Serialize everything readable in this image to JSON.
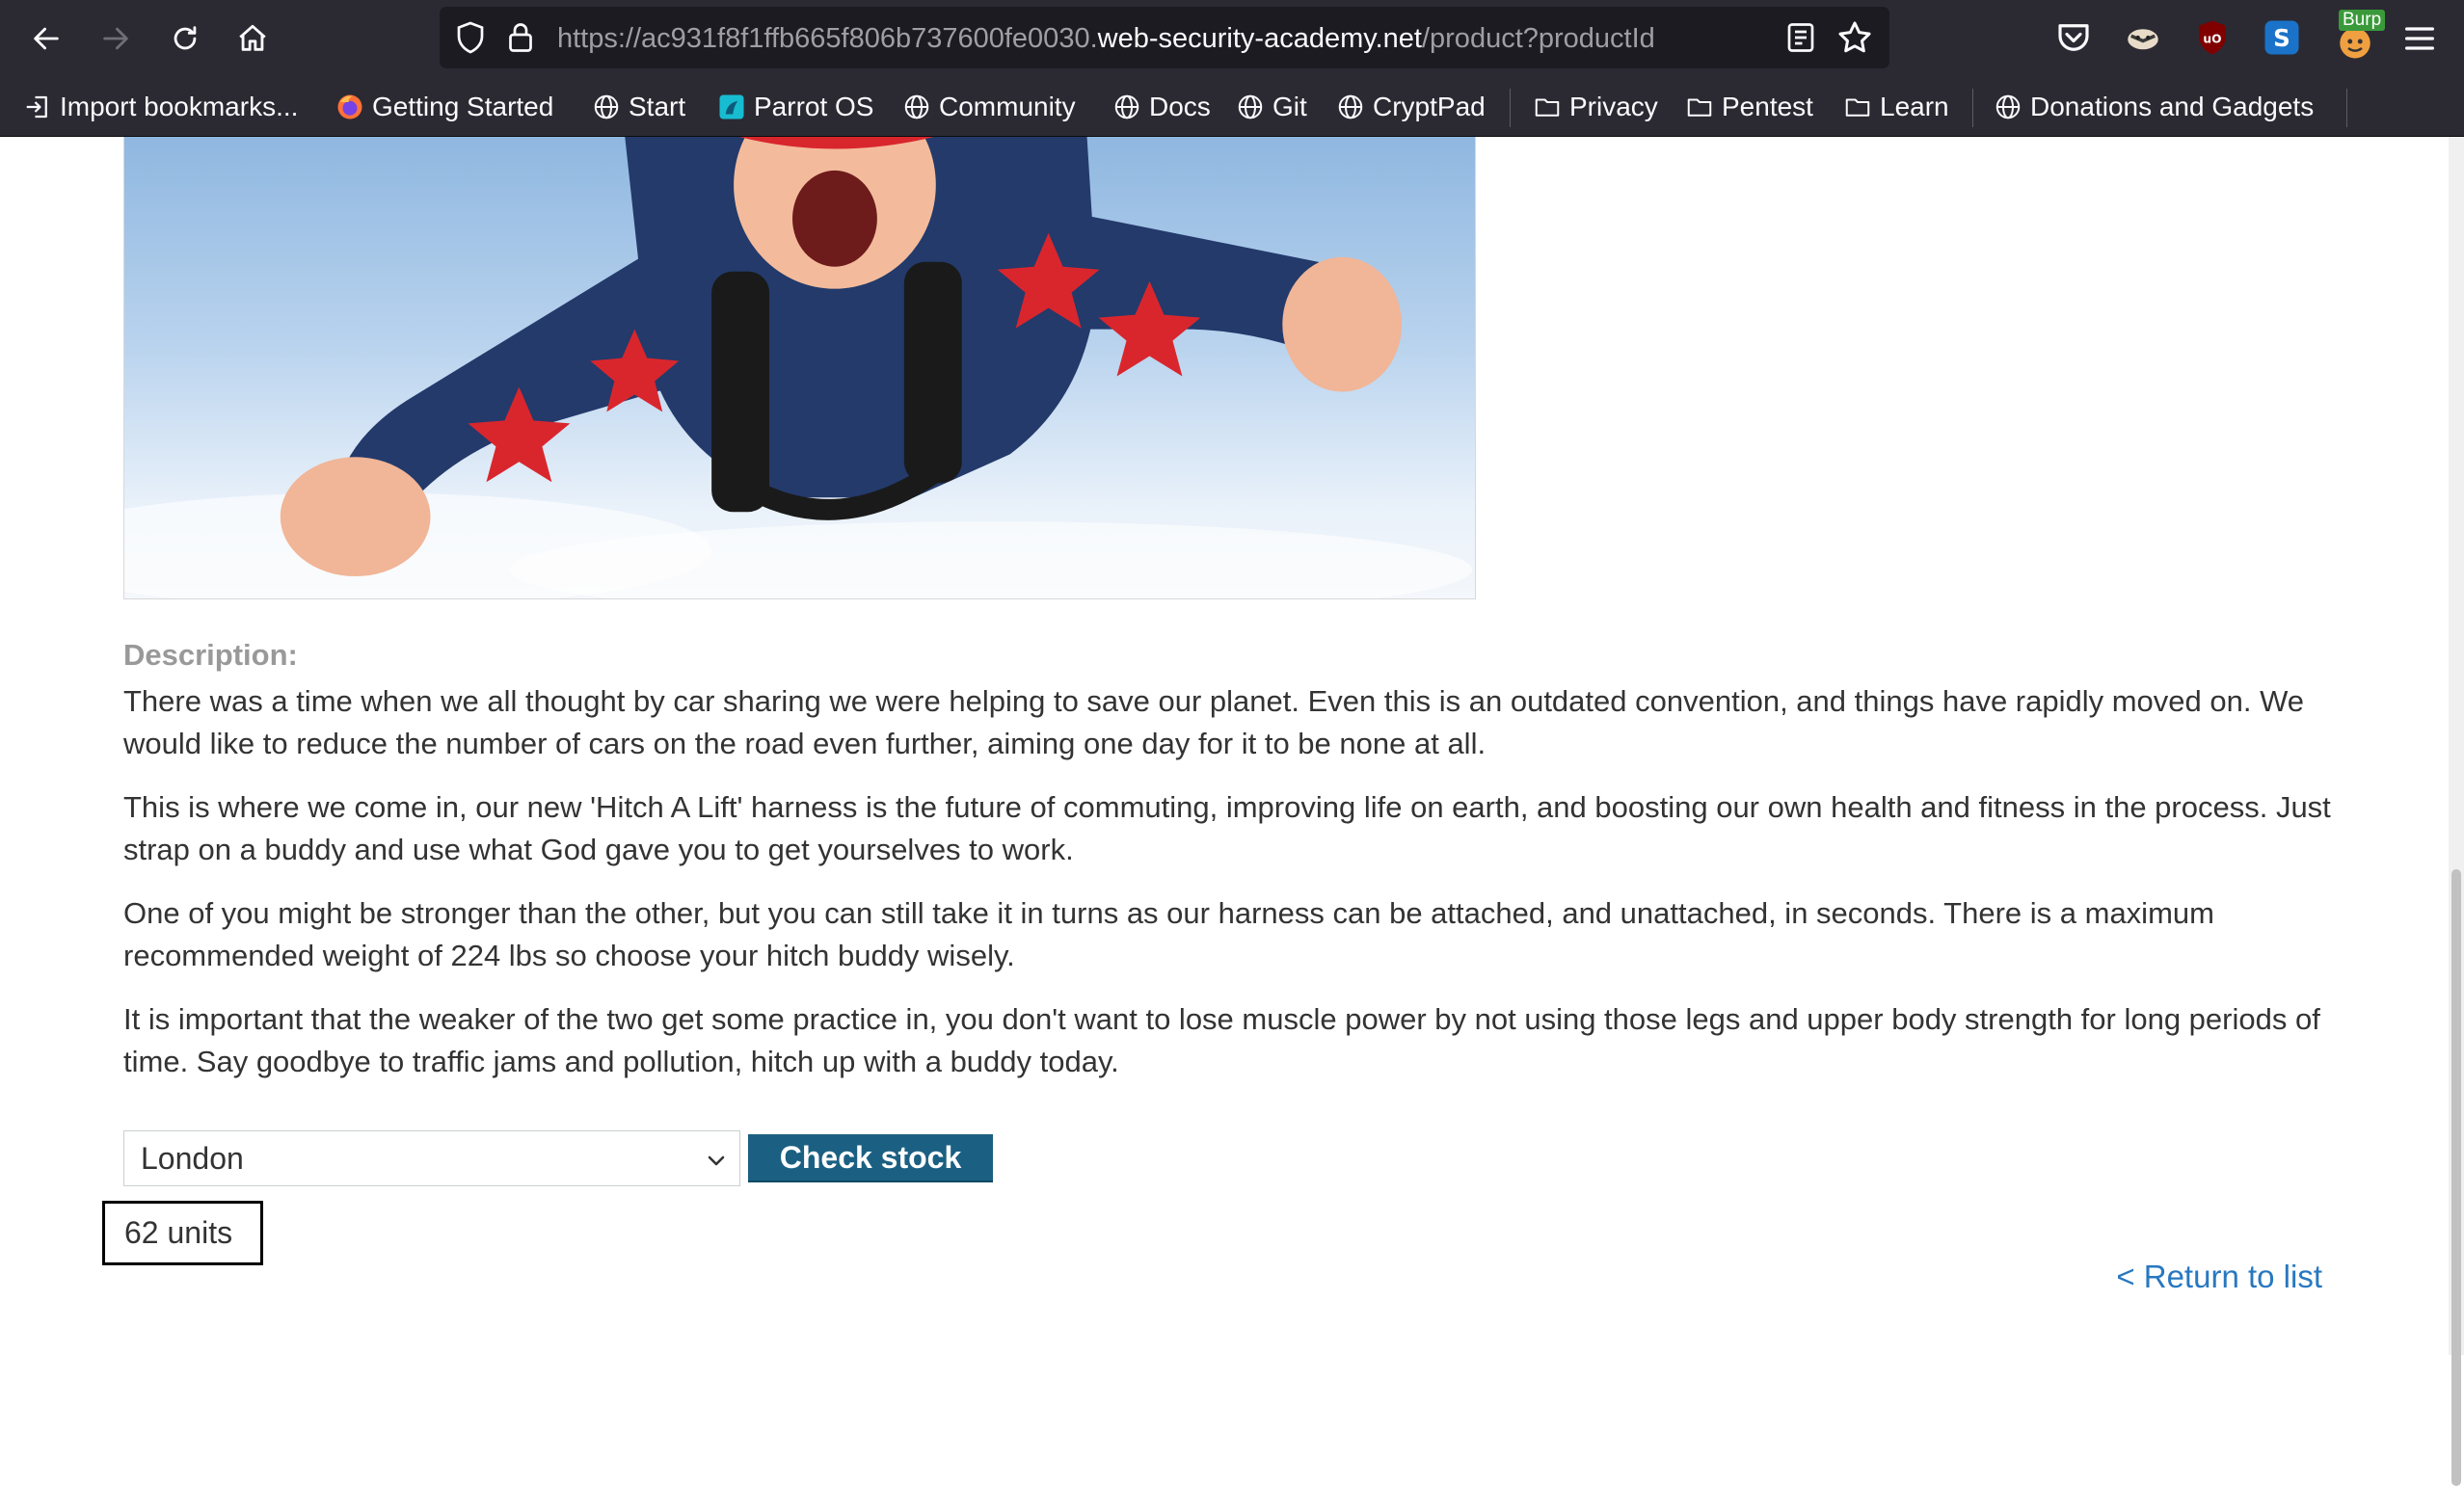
{
  "browser": {
    "url_prefix": "https://ac931f8f1ffb665f806b737600fe0030.",
    "url_host": "web-security-academy.net",
    "url_suffix": "/product?productId",
    "extension_badge": "Burp"
  },
  "bookmarks": [
    {
      "label": "Import bookmarks...",
      "icon": "import-icon"
    },
    {
      "label": "Getting Started",
      "icon": "firefox-icon"
    },
    {
      "label": "Start",
      "icon": "globe-icon"
    },
    {
      "label": "Parrot OS",
      "icon": "parrot-icon"
    },
    {
      "label": "Community",
      "icon": "globe-icon"
    },
    {
      "label": "Docs",
      "icon": "globe-icon"
    },
    {
      "label": "Git",
      "icon": "globe-icon"
    },
    {
      "label": "CryptPad",
      "icon": "globe-icon"
    },
    {
      "label": "Privacy",
      "icon": "folder-icon"
    },
    {
      "label": "Pentest",
      "icon": "folder-icon"
    },
    {
      "label": "Learn",
      "icon": "folder-icon"
    },
    {
      "label": "Donations and Gadgets",
      "icon": "globe-icon"
    }
  ],
  "product": {
    "description_label": "Description:",
    "paragraphs": [
      "There was a time when we all thought by car sharing we were helping to save our planet. Even this is an outdated convention, and things have rapidly moved on. We would like to reduce the number of cars on the road even further, aiming one day for it to be none at all.",
      "This is where we come in, our new 'Hitch A Lift' harness is the future of commuting, improving life on earth, and boosting our own health and fitness in the process. Just strap on a buddy and use what God gave you to get yourselves to work.",
      "One of you might be stronger than the other, but you can still take it in turns as our harness can be attached, and unattached, in seconds. There is a maximum recommended weight of 224 lbs so choose your hitch buddy wisely.",
      "It is important that the weaker of the two get some practice in, you don't want to lose muscle power by not using those legs and upper body strength for long periods of time. Say goodbye to traffic jams and pollution, hitch up with a buddy today."
    ]
  },
  "stock_check": {
    "selected_store": "London",
    "button_label": "Check stock",
    "result": "62 units"
  },
  "return_link": "< Return to list",
  "colors": {
    "chrome_bg": "#2b2a33",
    "url_bg": "#1c1b22",
    "button_bg": "#1b6082",
    "link": "#2878c0"
  }
}
